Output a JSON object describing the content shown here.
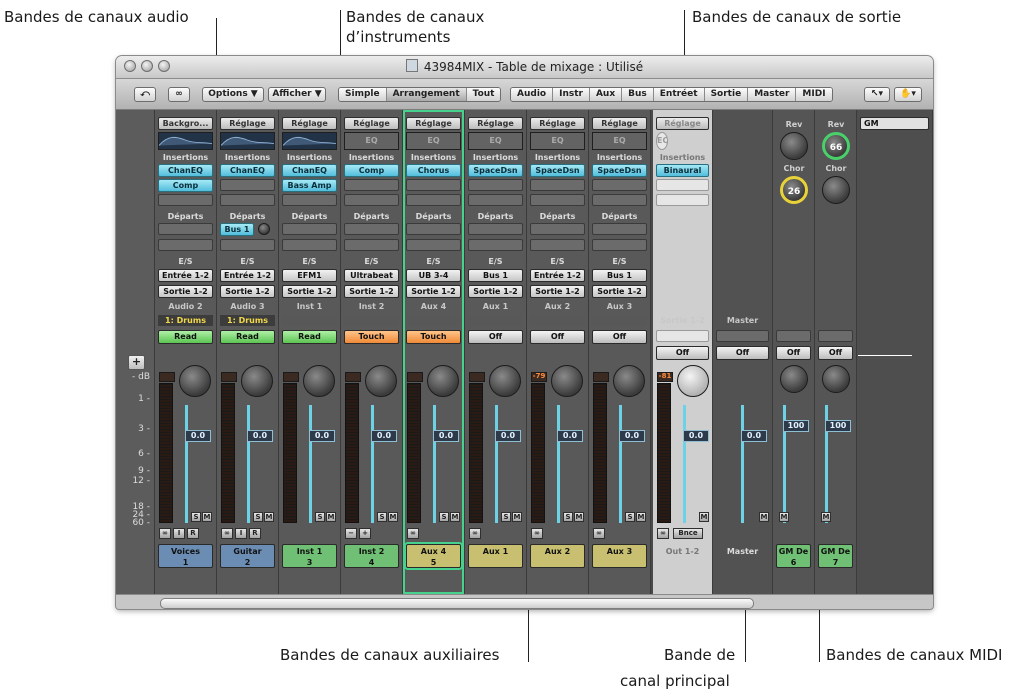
{
  "callouts": {
    "audio": "Bandes de canaux audio",
    "instruments_1": "Bandes de canaux",
    "instruments_2": "d’instruments",
    "sortie": "Bandes de canaux de sortie",
    "aux": "Bandes de canaux auxiliaires",
    "master_1": "Bande de",
    "master_2": "canal principal",
    "midi": "Bandes de canaux MIDI"
  },
  "window": {
    "title": "43984MIX - Table de mixage : Utilisé"
  },
  "toolbar": {
    "options": "Options ▼",
    "afficher": "Afficher ▼",
    "views": [
      "Simple",
      "Arrangement",
      "Tout"
    ],
    "filters": [
      "Audio",
      "Instr",
      "Aux",
      "Bus",
      "Entréet",
      "Sortie",
      "Master",
      "MIDI"
    ]
  },
  "labels": {
    "insertions": "Insertions",
    "departs": "Départs",
    "es": "E/S",
    "eq": "EQ"
  },
  "ruler_ticks": [
    "- dB",
    "1 -",
    "3 -",
    "6 -",
    "9 -",
    "12 -",
    "18 -",
    "24 -",
    "60 -"
  ],
  "strips": [
    {
      "setting": "Backgro...",
      "eq": "curve",
      "plugins": [
        "ChanEQ",
        "Comp"
      ],
      "send": "",
      "in": "Entrée 1-2",
      "out": "Sortie 1-2",
      "name": "Audio 2",
      "group": "1: Drums",
      "auto": "Read",
      "auto_type": "read",
      "vol": "0.0",
      "peak": "",
      "label": "Voices\n1",
      "color": "#6b8db4",
      "icons": [
        "∞",
        "I",
        "R"
      ],
      "sm": [
        "S",
        "M"
      ]
    },
    {
      "setting": "Réglage",
      "eq": "curve",
      "plugins": [
        "ChanEQ",
        ""
      ],
      "send": "Bus 1",
      "in": "Entrée 1-2",
      "out": "Sortie 1-2",
      "name": "Audio 3",
      "group": "1: Drums",
      "auto": "Read",
      "auto_type": "read",
      "vol": "0.0",
      "peak": "",
      "label": "Guitar\n2",
      "color": "#6b8db4",
      "icons": [
        "∞",
        "I",
        "R"
      ],
      "sm": [
        "S",
        "M"
      ]
    },
    {
      "setting": "Réglage",
      "eq": "curve",
      "plugins": [
        "ChanEQ",
        "Bass Amp"
      ],
      "send": "",
      "in": "EFM1",
      "out": "Sortie 1-2",
      "name": "Inst 1",
      "group": "",
      "auto": "Read",
      "auto_type": "read",
      "vol": "0.0",
      "peak": "",
      "label": "Inst 1\n3",
      "color": "#6fbf74",
      "icons": [],
      "sm": [
        "S",
        "M"
      ]
    },
    {
      "setting": "Réglage",
      "eq": "empty",
      "plugins": [
        "Comp",
        ""
      ],
      "send": "",
      "in": "Ultrabeat",
      "out": "Sortie 1-2",
      "name": "Inst 2",
      "group": "",
      "auto": "Touch",
      "auto_type": "touch",
      "vol": "0.0",
      "peak": "",
      "label": "Inst 2\n4",
      "color": "#6fbf74",
      "icons": [
        "−",
        "+"
      ],
      "sm": [
        "S",
        "M"
      ]
    },
    {
      "setting": "Réglage",
      "eq": "empty",
      "plugins": [
        "Chorus",
        ""
      ],
      "send": "",
      "in": "UB 3-4",
      "out": "Sortie 1-2",
      "name": "Aux 4",
      "group": "",
      "auto": "Touch",
      "auto_type": "touch",
      "vol": "0.0",
      "peak": "",
      "label": "Aux 4\n5",
      "color": "#c8c070",
      "icons": [
        "∞"
      ],
      "sm": [
        "S",
        "M"
      ]
    },
    {
      "setting": "Réglage",
      "eq": "empty",
      "plugins": [
        "SpaceDsn",
        ""
      ],
      "send": "",
      "in": "Bus 1",
      "out": "Sortie 1-2",
      "name": "Aux 1",
      "group": "",
      "auto": "Off",
      "auto_type": "off",
      "vol": "0.0",
      "peak": "",
      "label": "Aux 1",
      "color": "#c8c070",
      "icons": [
        "∞"
      ],
      "sm": [
        "S",
        "M"
      ]
    },
    {
      "setting": "Réglage",
      "eq": "empty",
      "plugins": [
        "SpaceDsn",
        ""
      ],
      "send": "",
      "in": "Entrée 1-2",
      "out": "Sortie 1-2",
      "name": "Aux 2",
      "group": "",
      "auto": "Off",
      "auto_type": "off",
      "vol": "0.0",
      "peak": "-79",
      "label": "Aux 2",
      "color": "#c8c070",
      "icons": [
        "∞"
      ],
      "sm": [
        "S",
        "M"
      ]
    },
    {
      "setting": "Réglage",
      "eq": "empty",
      "plugins": [
        "SpaceDsn",
        ""
      ],
      "send": "",
      "in": "Bus 1",
      "out": "Sortie 1-2",
      "name": "Aux 3",
      "group": "",
      "auto": "Off",
      "auto_type": "off",
      "vol": "0.0",
      "peak": "",
      "label": "Aux 3",
      "color": "#c8c070",
      "icons": [
        "∞"
      ],
      "sm": [
        "S",
        "M"
      ]
    }
  ],
  "output_strip": {
    "setting": "Réglage",
    "plugin": "Binaural",
    "name": "Sortie 1-2",
    "auto": "Off",
    "vol": "0.0",
    "peak": "-81",
    "bnce": "Bnce",
    "label": "Out 1-2",
    "mute": "M"
  },
  "master_strip": {
    "name": "Master",
    "auto": "Off",
    "vol": "0.0",
    "label": "Master",
    "mute": "M"
  },
  "midi_strips": [
    {
      "rev": "Rev",
      "chor": "Chor",
      "chor_value": "26",
      "rev_value": "",
      "auto": "Off",
      "vol": "100",
      "label": "GM De\n6",
      "mute": "M"
    },
    {
      "rev": "Rev",
      "chor": "Chor",
      "chor_value": "",
      "rev_value": "66",
      "auto": "Off",
      "vol": "100",
      "label": "GM De\n7",
      "mute": "M"
    }
  ],
  "gm_field": "GM"
}
